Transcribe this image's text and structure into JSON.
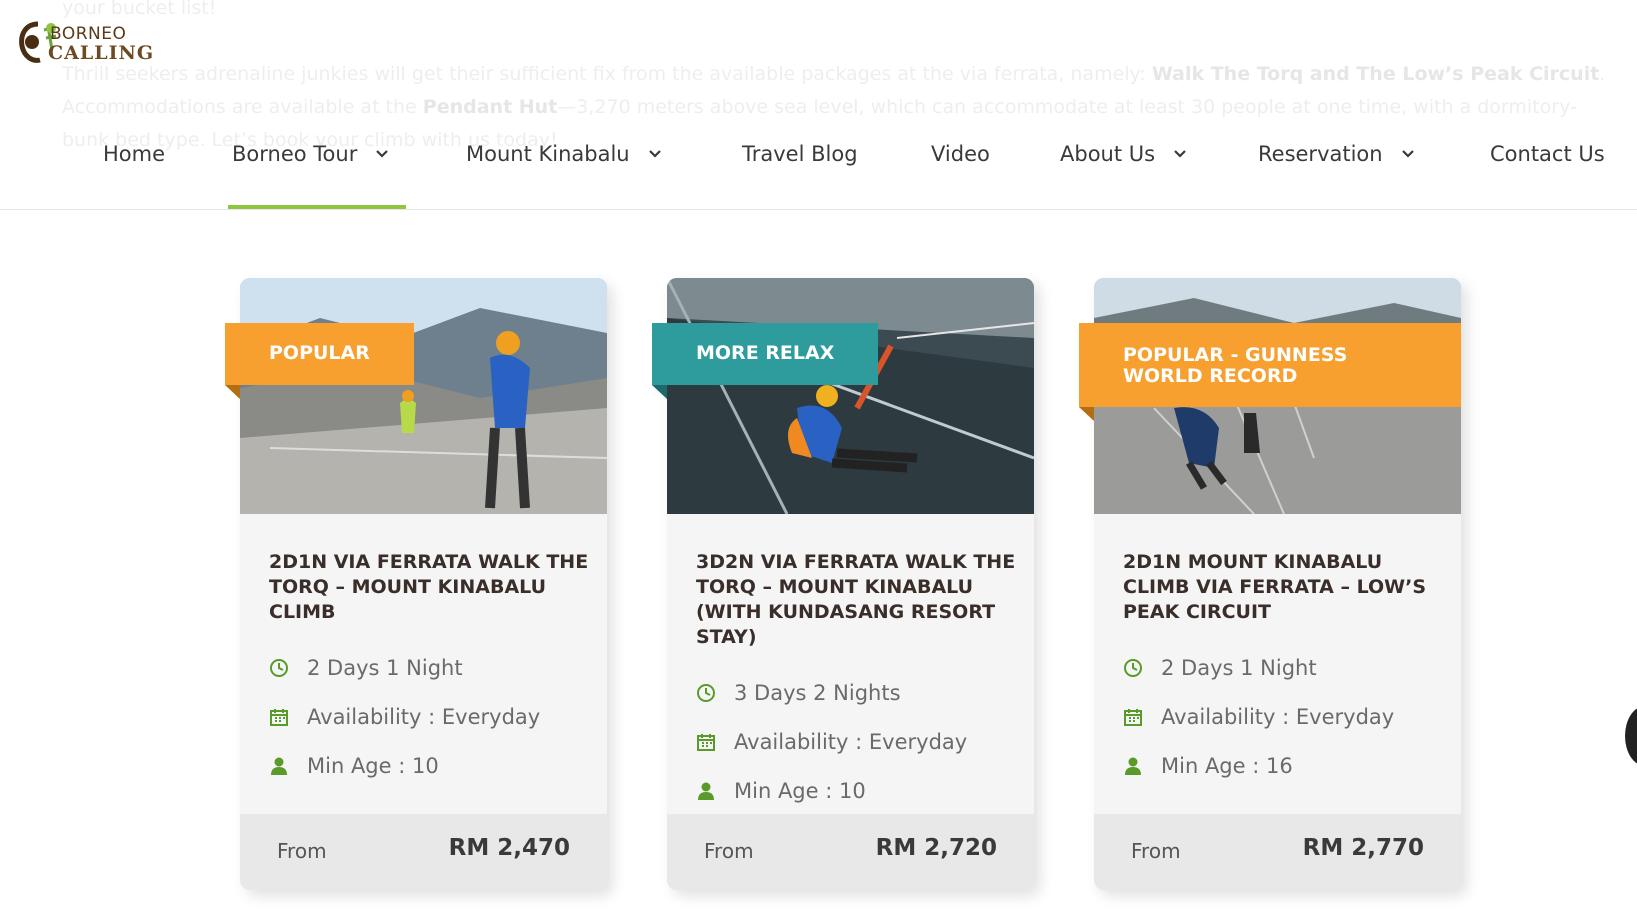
{
  "background_text": {
    "line1": "your bucket list!",
    "line2_pre": "Thrill seekers adrenaline junkies will get their sufficient fix from the available packages at the via ferrata, namely: ",
    "line2_bold": "Walk The Torq and The Low’s Peak Circuit",
    "line2_post": ".",
    "line3_pre": "Accommodations are available at the ",
    "line3_bold": "Pendant Hut",
    "line3_post": "—3,270 meters above sea level, which can accommodate at least 30 people at one time, with a dormitory-",
    "line4": "bunk bed type. Let’s book your climb with us today!"
  },
  "logo": {
    "top": "BORNEO",
    "bottom": "CALLING"
  },
  "nav": {
    "items": [
      {
        "label": "Home",
        "dropdown": false
      },
      {
        "label": "Borneo Tour",
        "dropdown": true,
        "active": true
      },
      {
        "label": "Mount Kinabalu",
        "dropdown": true
      },
      {
        "label": "Travel Blog",
        "dropdown": false
      },
      {
        "label": "Video",
        "dropdown": false
      },
      {
        "label": "About Us",
        "dropdown": true
      },
      {
        "label": "Reservation",
        "dropdown": true
      },
      {
        "label": "Contact Us",
        "dropdown": false
      }
    ]
  },
  "colors": {
    "accent_green": "#8dc63f",
    "ribbon_orange": "#f7a030",
    "ribbon_teal": "#2e9b9d",
    "icon_green": "#5a9a2a"
  },
  "cards": [
    {
      "badge": "POPULAR",
      "title": "2D1N VIA FERRATA WALK THE TORQ – MOUNT KINABALU CLIMB",
      "duration": "2 Days 1 Night",
      "availability": "Availability : Everyday",
      "min_age": "Min Age : 10",
      "from_label": "From",
      "price": "RM 2,470"
    },
    {
      "badge": "MORE RELAX",
      "title": "3D2N VIA FERRATA WALK THE TORQ – MOUNT KINABALU (WITH KUNDASANG RESORT STAY)",
      "duration": "3 Days 2 Nights",
      "availability": "Availability : Everyday",
      "min_age": "Min Age : 10",
      "from_label": "From",
      "price": "RM 2,720"
    },
    {
      "badge": "POPULAR - GUNNESS WORLD RECORD",
      "title": "2D1N MOUNT KINABALU CLIMB VIA FERRATA – LOW’S PEAK CIRCUIT",
      "duration": "2 Days 1 Night",
      "availability": "Availability : Everyday",
      "min_age": "Min Age : 16",
      "from_label": "From",
      "price": "RM 2,770"
    }
  ]
}
